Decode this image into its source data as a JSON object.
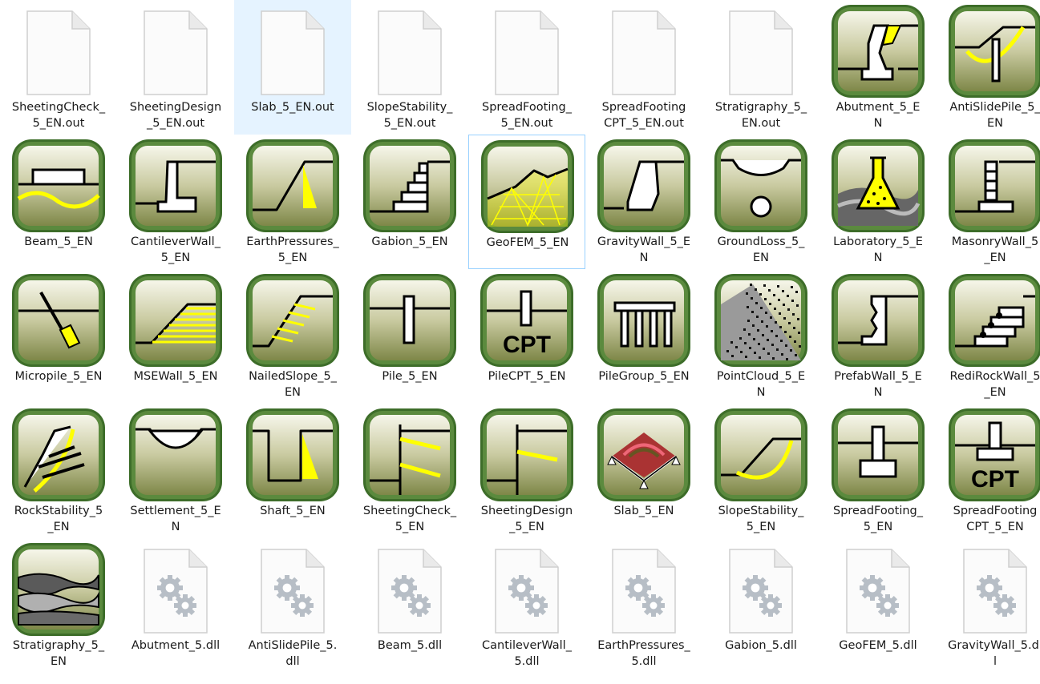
{
  "items": [
    {
      "name": "SheetingCheck_5_EN.out",
      "label": "SheetingCheck_\n5_EN.out",
      "icon": "blank-file-icon"
    },
    {
      "name": "SheetingDesign_5_EN.out",
      "label": "SheetingDesign\n_5_EN.out",
      "icon": "blank-file-icon"
    },
    {
      "name": "Slab_5_EN.out",
      "label": "Slab_5_EN.out",
      "icon": "blank-file-icon",
      "selected": true
    },
    {
      "name": "SlopeStability_5_EN.out",
      "label": "SlopeStability_\n5_EN.out",
      "icon": "blank-file-icon"
    },
    {
      "name": "SpreadFooting_5_EN.out",
      "label": "SpreadFooting_\n5_EN.out",
      "icon": "blank-file-icon"
    },
    {
      "name": "SpreadFootingCPT_5_EN.out",
      "label": "SpreadFooting\nCPT_5_EN.out",
      "icon": "blank-file-icon"
    },
    {
      "name": "Stratigraphy_5_EN.out",
      "label": "Stratigraphy_5_\nEN.out",
      "icon": "blank-file-icon"
    },
    {
      "name": "Abutment_5_EN",
      "label": "Abutment_5_E\nN",
      "icon": "abutment-icon"
    },
    {
      "name": "AntiSlidePile_5_EN",
      "label": "AntiSlidePile_5_\nEN",
      "icon": "antislidepile-icon"
    },
    {
      "name": "Beam_5_EN",
      "label": "Beam_5_EN",
      "icon": "beam-icon"
    },
    {
      "name": "CantileverWall_5_EN",
      "label": "CantileverWall_\n5_EN",
      "icon": "cantileverwall-icon"
    },
    {
      "name": "EarthPressures_5_EN",
      "label": "EarthPressures_\n5_EN",
      "icon": "earthpressures-icon"
    },
    {
      "name": "Gabion_5_EN",
      "label": "Gabion_5_EN",
      "icon": "gabion-icon"
    },
    {
      "name": "GeoFEM_5_EN",
      "label": "GeoFEM_5_EN",
      "icon": "geofem-icon",
      "focused": true
    },
    {
      "name": "GravityWall_5_EN",
      "label": "GravityWall_5_E\nN",
      "icon": "gravitywall-icon"
    },
    {
      "name": "GroundLoss_5_EN",
      "label": "GroundLoss_5_\nEN",
      "icon": "groundloss-icon"
    },
    {
      "name": "Laboratory_5_EN",
      "label": "Laboratory_5_E\nN",
      "icon": "laboratory-icon"
    },
    {
      "name": "MasonryWall_5_EN",
      "label": "MasonryWall_5\n_EN",
      "icon": "masonrywall-icon"
    },
    {
      "name": "Micropile_5_EN",
      "label": "Micropile_5_EN",
      "icon": "micropile-icon"
    },
    {
      "name": "MSEWall_5_EN",
      "label": "MSEWall_5_EN",
      "icon": "msewall-icon"
    },
    {
      "name": "NailedSlope_5_EN",
      "label": "NailedSlope_5_\nEN",
      "icon": "nailedslope-icon"
    },
    {
      "name": "Pile_5_EN",
      "label": "Pile_5_EN",
      "icon": "pile-icon"
    },
    {
      "name": "PileCPT_5_EN",
      "label": "PileCPT_5_EN",
      "icon": "pilecpt-icon",
      "cpt_text": "CPT"
    },
    {
      "name": "PileGroup_5_EN",
      "label": "PileGroup_5_EN",
      "icon": "pilegroup-icon"
    },
    {
      "name": "PointCloud_5_EN",
      "label": "PointCloud_5_E\nN",
      "icon": "pointcloud-icon"
    },
    {
      "name": "PrefabWall_5_EN",
      "label": "PrefabWall_5_E\nN",
      "icon": "prefabwall-icon"
    },
    {
      "name": "RediRockWall_5_EN",
      "label": "RediRockWall_5\n_EN",
      "icon": "redirockwall-icon"
    },
    {
      "name": "RockStability_5_EN",
      "label": "RockStability_5\n_EN",
      "icon": "rockstability-icon"
    },
    {
      "name": "Settlement_5_EN",
      "label": "Settlement_5_E\nN",
      "icon": "settlement-icon"
    },
    {
      "name": "Shaft_5_EN",
      "label": "Shaft_5_EN",
      "icon": "shaft-icon"
    },
    {
      "name": "SheetingCheck_5_EN",
      "label": "SheetingCheck_\n5_EN",
      "icon": "sheetingcheck-icon"
    },
    {
      "name": "SheetingDesign_5_EN",
      "label": "SheetingDesign\n_5_EN",
      "icon": "sheetingdesign-icon"
    },
    {
      "name": "Slab_5_EN",
      "label": "Slab_5_EN",
      "icon": "slab-icon"
    },
    {
      "name": "SlopeStability_5_EN",
      "label": "SlopeStability_\n5_EN",
      "icon": "slopestability-icon"
    },
    {
      "name": "SpreadFooting_5_EN",
      "label": "SpreadFooting_\n5_EN",
      "icon": "spreadfooting-icon"
    },
    {
      "name": "SpreadFootingCPT_5_EN",
      "label": "SpreadFooting\nCPT_5_EN",
      "icon": "spreadfootingcpt-icon",
      "cpt_text": "CPT"
    },
    {
      "name": "Stratigraphy_5_EN",
      "label": "Stratigraphy_5_\nEN",
      "icon": "stratigraphy-icon"
    },
    {
      "name": "Abutment_5.dll",
      "label": "Abutment_5.dll",
      "icon": "dll-gears-icon"
    },
    {
      "name": "AntiSlidePile_5.dll",
      "label": "AntiSlidePile_5.\ndll",
      "icon": "dll-gears-icon"
    },
    {
      "name": "Beam_5.dll",
      "label": "Beam_5.dll",
      "icon": "dll-gears-icon"
    },
    {
      "name": "CantileverWall_5.dll",
      "label": "CantileverWall_\n5.dll",
      "icon": "dll-gears-icon"
    },
    {
      "name": "EarthPressures_5.dll",
      "label": "EarthPressures_\n5.dll",
      "icon": "dll-gears-icon"
    },
    {
      "name": "Gabion_5.dll",
      "label": "Gabion_5.dll",
      "icon": "dll-gears-icon"
    },
    {
      "name": "GeoFEM_5.dll",
      "label": "GeoFEM_5.dll",
      "icon": "dll-gears-icon"
    },
    {
      "name": "GravityWall_5.dll",
      "label": "GravityWall_5.dl\nl",
      "icon": "dll-gears-icon"
    }
  ],
  "colors": {
    "accent_yellow": "#ffff00",
    "icon_border": "#3f6f2a",
    "selection": "#e5f3ff"
  }
}
